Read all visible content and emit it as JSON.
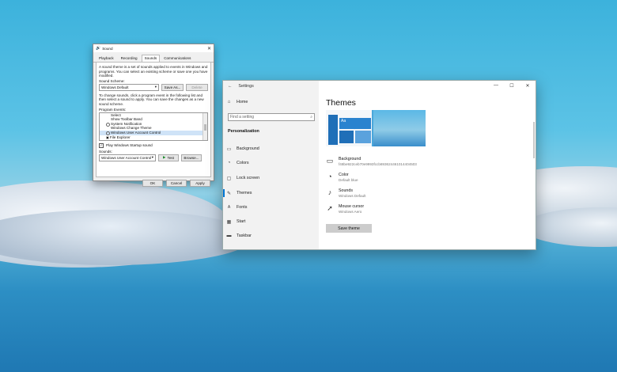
{
  "sound_dialog": {
    "title": "Sound",
    "tabs": [
      "Playback",
      "Recording",
      "Sounds",
      "Communications"
    ],
    "intro": "A sound theme is a set of sounds applied to events in Windows and programs. You can select an existing scheme or save one you have modified.",
    "scheme_label": "Sound Scheme:",
    "scheme_value": "Windows Default",
    "save_as_label": "Save As...",
    "delete_label": "Delete",
    "change_text": "To change sounds, click a program event in the following list and then select a sound to apply. You can save the changes as a new sound scheme.",
    "events_label": "Program Events:",
    "events": [
      {
        "label": "Select"
      },
      {
        "label": "Show Toolbar Band"
      },
      {
        "label": "System Notification"
      },
      {
        "label": "Windows Change Theme"
      },
      {
        "label": "Windows User Account Control"
      },
      {
        "label": "File Explorer"
      }
    ],
    "startup_label": "Play Windows Startup sound",
    "sounds_label": "Sounds:",
    "sounds_value": "Windows User Account Control",
    "test_label": "Test",
    "browse_label": "Browse...",
    "ok_label": "OK",
    "cancel_label": "Cancel",
    "apply_label": "Apply"
  },
  "settings": {
    "window_title": "Settings",
    "home_label": "Home",
    "search_placeholder": "Find a setting",
    "section_label": "Personalization",
    "nav": [
      {
        "label": "Background",
        "icon": "picture-icon"
      },
      {
        "label": "Colors",
        "icon": "palette-icon"
      },
      {
        "label": "Lock screen",
        "icon": "lock-screen-icon"
      },
      {
        "label": "Themes",
        "icon": "themes-icon"
      },
      {
        "label": "Fonts",
        "icon": "fonts-icon"
      },
      {
        "label": "Start",
        "icon": "start-icon"
      },
      {
        "label": "Taskbar",
        "icon": "taskbar-icon"
      }
    ],
    "page_title": "Themes",
    "preview_tile": "Aa",
    "items": [
      {
        "label": "Background",
        "value": "f48be922ceb70e9993fccb693624461014404503",
        "icon": "picture-icon"
      },
      {
        "label": "Color",
        "value": "Default blue",
        "icon": "palette-icon"
      },
      {
        "label": "Sounds",
        "value": "Windows Default",
        "icon": "speaker-icon"
      },
      {
        "label": "Mouse cursor",
        "value": "Windows Aero",
        "icon": "cursor-icon"
      }
    ],
    "save_theme_label": "Save theme",
    "accent_color": "#0078d7"
  }
}
